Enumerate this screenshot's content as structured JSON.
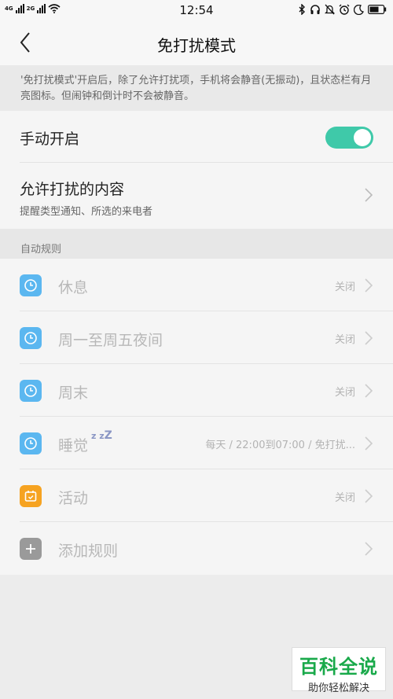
{
  "status": {
    "net1": "4G",
    "net2": "2G",
    "time": "12:54"
  },
  "nav": {
    "title": "免打扰模式"
  },
  "info": {
    "text": "'免打扰模式'开启后，除了允许打扰项，手机将会静音(无振动)，且状态栏有月亮图标。但闹钟和倒计时不会被静音。"
  },
  "manual": {
    "label": "手动开启",
    "enabled": true
  },
  "allow": {
    "title": "允许打扰的内容",
    "subtitle": "提醒类型通知、所选的来电者"
  },
  "rules": {
    "header": "自动规则",
    "items": [
      {
        "name": "休息",
        "status": "关闭",
        "icon": "clock-icon"
      },
      {
        "name": "周一至周五夜间",
        "status": "关闭",
        "icon": "clock-icon"
      },
      {
        "name": "周末",
        "status": "关闭",
        "icon": "clock-icon"
      },
      {
        "name": "睡觉",
        "status": "每天 / 22:00到07:00 / 免打扰...",
        "icon": "clock-icon"
      },
      {
        "name": "活动",
        "status": "关闭",
        "icon": "calendar-icon"
      },
      {
        "name": "添加规则",
        "status": "",
        "icon": "plus-icon"
      }
    ]
  },
  "colors": {
    "accent": "#3fc9a9",
    "clock_icon": "#5bb7f0",
    "calendar_icon": "#f6a321",
    "plus_icon": "#9a9a9a"
  },
  "watermark": {
    "top": "百科全说",
    "bottom": "助你轻松解决"
  }
}
